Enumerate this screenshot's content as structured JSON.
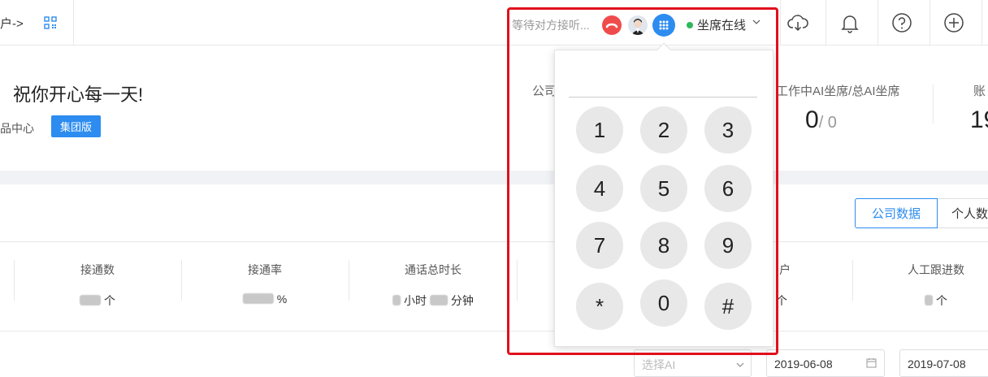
{
  "header": {
    "breadcrumb": "户->",
    "call_status": "等待对方接听...",
    "agent_status": "坐席在线"
  },
  "welcome": {
    "greeting": "祝你开心每一天!",
    "product_center": "品中心",
    "edition": "集团版"
  },
  "summary": {
    "company_label": "公司",
    "ai_seats_label": "工作中AI坐席/总AI坐席",
    "ai_seats_working": "0",
    "ai_seats_total": "/ 0",
    "account_label": "账",
    "account_value": "19"
  },
  "data_tabs": {
    "company": "公司数据",
    "personal": "个人数"
  },
  "metrics": [
    {
      "label": "接通数",
      "unit": "个"
    },
    {
      "label": "接通率",
      "unit": "%"
    },
    {
      "label": "通话总时长",
      "unit_hours": "小时",
      "unit_minutes": "分钟"
    },
    {
      "label": "户",
      "unit": "个"
    },
    {
      "label": "人工跟进数",
      "unit": "个"
    }
  ],
  "filters": {
    "ai_select_placeholder": "选择AI",
    "start_date": "2019-06-08",
    "end_date": "2019-07-08"
  },
  "dialpad": {
    "keys": [
      "1",
      "2",
      "3",
      "4",
      "5",
      "6",
      "7",
      "8",
      "9",
      "*",
      "0",
      "#"
    ]
  },
  "colors": {
    "primary": "#2d8cf0",
    "hangup": "#f04b4b",
    "online": "#2eb85c",
    "highlight": "#e0101c"
  }
}
